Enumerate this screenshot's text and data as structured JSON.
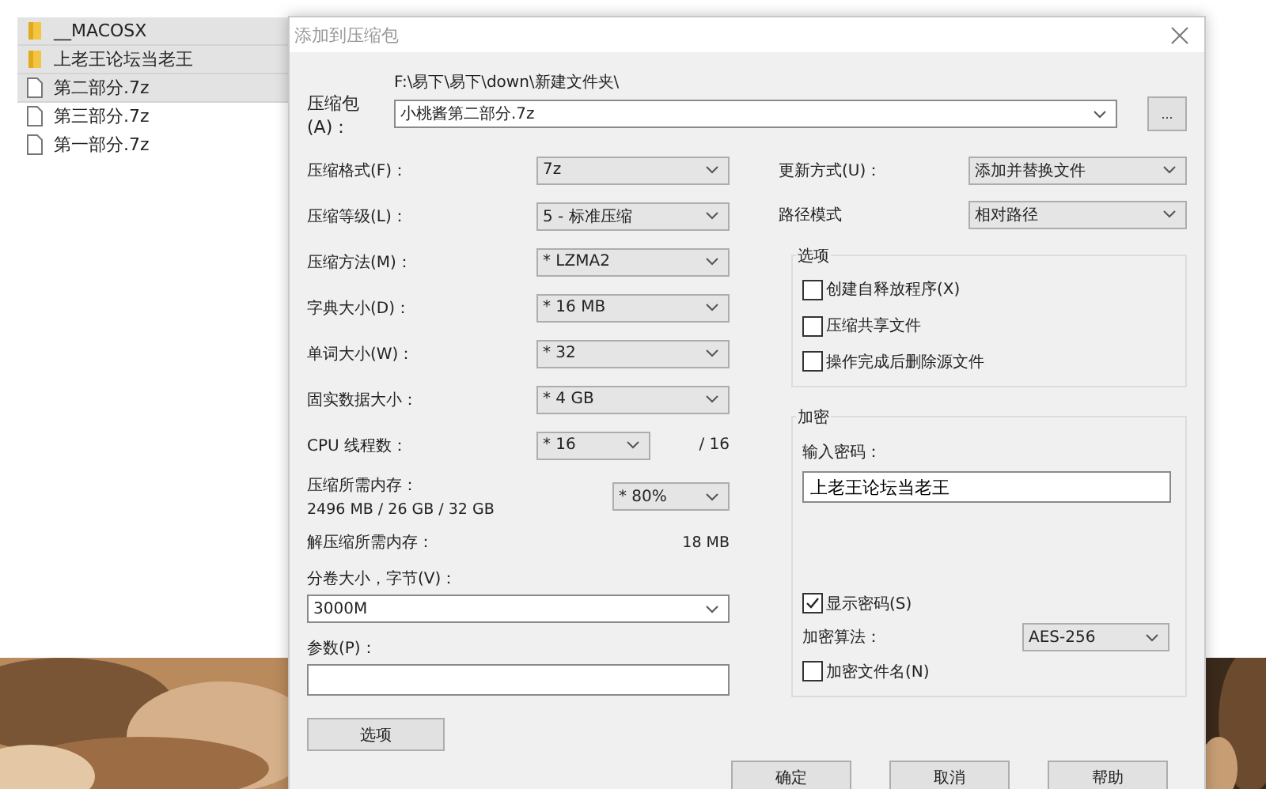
{
  "explorer": {
    "files": [
      {
        "name": "__MACOSX",
        "kind": "folder",
        "selected": true
      },
      {
        "name": "上老王论坛当老王",
        "kind": "folder",
        "selected": true
      },
      {
        "name": "第二部分.7z",
        "kind": "file",
        "selected": true
      },
      {
        "name": "第三部分.7z",
        "kind": "file",
        "selected": false
      },
      {
        "name": "第一部分.7z",
        "kind": "file",
        "selected": false
      }
    ]
  },
  "dialog": {
    "title": "添加到压缩包",
    "archive": {
      "label": "压缩包(A)：",
      "path": "F:\\易下\\易下\\down\\新建文件夹\\",
      "value": "小桃酱第二部分.7z",
      "browse": "..."
    },
    "settings": [
      {
        "label": "压缩格式(F)：",
        "value": "7z"
      },
      {
        "label": "压缩等级(L)：",
        "value": "5 - 标准压缩"
      },
      {
        "label": "压缩方法(M)：",
        "value": "* LZMA2"
      },
      {
        "label": "字典大小(D)：",
        "value": "* 16 MB"
      },
      {
        "label": "单词大小(W)：",
        "value": "* 32"
      },
      {
        "label": "固实数据大小：",
        "value": "* 4 GB"
      }
    ],
    "threads": {
      "label": "CPU 线程数：",
      "value": "* 16",
      "max": "/ 16"
    },
    "memory": {
      "label": "压缩所需内存：",
      "detail": "2496 MB / 26 GB / 32 GB",
      "value": "* 80%"
    },
    "decompress_memory": {
      "label": "解压缩所需内存：",
      "value": "18 MB"
    },
    "volume": {
      "label": "分卷大小，字节(V)：",
      "value": "3000M"
    },
    "parameters": {
      "label": "参数(P)："
    },
    "options_button": "选项",
    "update_mode": {
      "label": "更新方式(U)：",
      "value": "添加并替换文件"
    },
    "path_mode": {
      "label": "路径模式",
      "value": "相对路径"
    },
    "options": {
      "title": "选项",
      "checkboxes": [
        {
          "label": "创建自释放程序(X)",
          "checked": false
        },
        {
          "label": "压缩共享文件",
          "checked": false
        },
        {
          "label": "操作完成后删除源文件",
          "checked": false
        }
      ]
    },
    "encryption": {
      "title": "加密",
      "password_label": "输入密码：",
      "password": "上老王论坛当老王",
      "show_password": {
        "label": "显示密码(S)",
        "checked": true
      },
      "method": {
        "label": "加密算法：",
        "value": "AES-256"
      },
      "encrypt_names": {
        "label": "加密文件名(N)",
        "checked": false
      }
    },
    "buttons": [
      "确定",
      "取消",
      "帮助"
    ]
  }
}
